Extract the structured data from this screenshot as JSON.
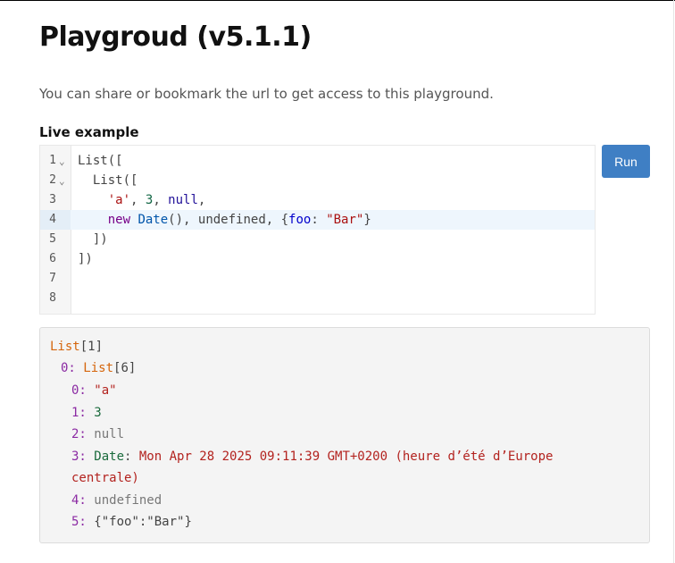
{
  "page": {
    "title": "Playgroud (v5.1.1)",
    "subtitle": "You can share or bookmark the url to get access to this playground.",
    "section_label": "Live example"
  },
  "editor": {
    "lines": [
      {
        "num": "1",
        "fold": "⌄"
      },
      {
        "num": "2",
        "fold": "⌄"
      },
      {
        "num": "3",
        "fold": ""
      },
      {
        "num": "4",
        "fold": ""
      },
      {
        "num": "5",
        "fold": ""
      },
      {
        "num": "6",
        "fold": ""
      },
      {
        "num": "7",
        "fold": ""
      },
      {
        "num": "8",
        "fold": ""
      }
    ],
    "tokens": {
      "l1": {
        "a": "List(["
      },
      "l2": {
        "a": "  List(["
      },
      "l3": {
        "indent": "    ",
        "str": "'a'",
        "c1": ", ",
        "num": "3",
        "c2": ", ",
        "atom": "null",
        "c3": ","
      },
      "l4": {
        "indent": "    ",
        "kw": "new",
        "sp": " ",
        "var": "Date",
        "c1": "(), ",
        "undef": "undefined",
        "c2": ", {",
        "prop": "foo",
        "c3": ": ",
        "str": "\"Bar\"",
        "c4": "}"
      },
      "l5": {
        "a": "  ])"
      },
      "l6": {
        "a": "])"
      }
    },
    "active_line": 4
  },
  "run_button": {
    "label": "Run"
  },
  "output": {
    "l1": {
      "type": "List",
      "rest": "[1]"
    },
    "l2": {
      "key": "0: ",
      "type": "List",
      "rest": "[6]"
    },
    "l3": {
      "key": "0: ",
      "val": "\"a\""
    },
    "l4": {
      "key": "1: ",
      "val": "3"
    },
    "l5": {
      "key": "2: ",
      "val": "null"
    },
    "l6": {
      "key": "3: ",
      "type": "Date",
      "colon": ": ",
      "val": "Mon Apr 28 2025 09:11:39 GMT+0200 (heure d’été d’Europe"
    },
    "l7": {
      "val": "centrale)"
    },
    "l8": {
      "key": "4: ",
      "val": "undefined"
    },
    "l9": {
      "key": "5: ",
      "val": "{\"foo\":\"Bar\"}"
    }
  },
  "colors": {
    "run_button": "#3f7fc4",
    "type": "#d5650c",
    "key": "#8b2aa3",
    "string": "#b3231f",
    "number": "#1b6b3d"
  }
}
